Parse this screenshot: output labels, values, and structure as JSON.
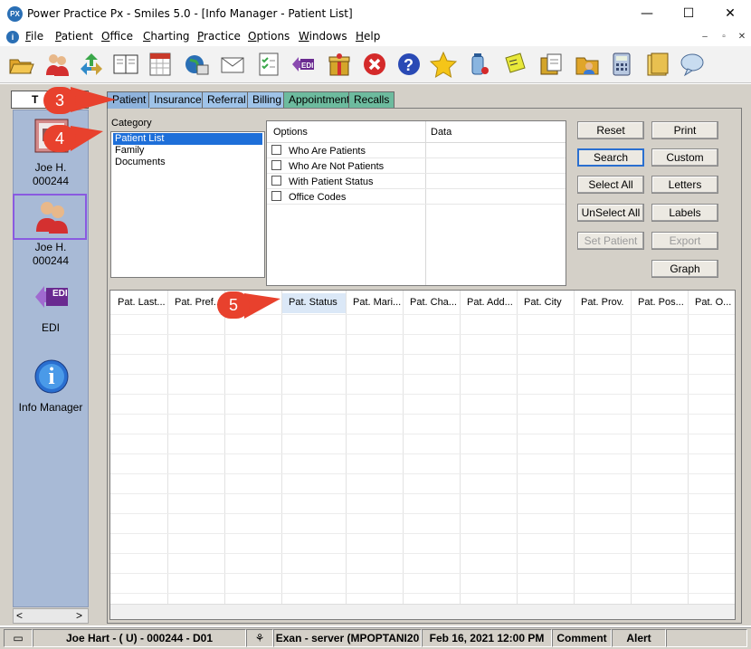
{
  "window": {
    "logo": "PX",
    "title": "Power Practice Px - Smiles 5.0 - [Info Manager - Patient List]",
    "minimize": "—",
    "maximize": "☐",
    "close": "✕"
  },
  "menu": [
    {
      "label": "File",
      "accel": "F",
      "rest": "ile"
    },
    {
      "label": "Patient",
      "accel": "P",
      "rest": "atient"
    },
    {
      "label": "Office",
      "accel": "O",
      "rest": "ffice"
    },
    {
      "label": "Charting",
      "accel": "C",
      "rest": "harting"
    },
    {
      "label": "Practice",
      "accel": "P",
      "rest": "ractice"
    },
    {
      "label": "Options",
      "accel": "O",
      "rest": "ptions"
    },
    {
      "label": "Windows",
      "accel": "W",
      "rest": "indows"
    },
    {
      "label": "Help",
      "accel": "H",
      "rest": "elp"
    }
  ],
  "mdi_controls": {
    "minimize": "–",
    "restore": "▫",
    "close": "✕"
  },
  "toolbar_icons": [
    "open-folder-icon",
    "patient-icon",
    "recycle-icon",
    "book-icon",
    "calendar-chart-icon",
    "globe-icon",
    "mail-icon",
    "checklist-icon",
    "edi-icon",
    "gift-icon",
    "cancel-icon",
    "help-icon",
    "star-icon",
    "medicine-icon",
    "note-icon",
    "document-icon",
    "folder-person-icon",
    "calculator-icon",
    "folder-icon",
    "speech-bubble-icon"
  ],
  "sidebar": {
    "header": "T",
    "items": [
      {
        "name": "Joe H.",
        "id": "000244"
      },
      {
        "name": "Joe H.",
        "id": "000244"
      },
      {
        "name": "EDI"
      },
      {
        "name": "Info Manager"
      }
    ],
    "edi_glyph": "EDI",
    "info_glyph": "i",
    "scroll_left": "<",
    "scroll_right": ">"
  },
  "tabs": [
    "Patient",
    "Insurance",
    "Referral",
    "Billing",
    "Appointment",
    "Recalls"
  ],
  "category": {
    "label": "Category",
    "items": [
      "Patient List",
      "Family",
      "Documents"
    ],
    "selected": "Patient List"
  },
  "options": {
    "header": "Options",
    "data_header": "Data",
    "rows": [
      "Who Are Patients",
      "Who Are Not Patients",
      "With Patient Status",
      "Office Codes"
    ]
  },
  "buttons": {
    "reset": "Reset",
    "print": "Print",
    "search": "Search",
    "custom": "Custom",
    "select_all": "Select All",
    "letters": "Letters",
    "unselect_all": "UnSelect All",
    "labels": "Labels",
    "set_patient": "Set Patient",
    "export": "Export",
    "graph": "Graph"
  },
  "grid": {
    "columns": [
      "Pat. Last...",
      "Pat. Pref...",
      "Pat. ...o",
      "Pat. Status",
      "Pat. Mari...",
      "Pat. Cha...",
      "Pat. Add...",
      "Pat. City",
      "Pat. Prov.",
      "Pat. Pos...",
      "Pat. O..."
    ],
    "selected_column": "Pat. Status"
  },
  "callouts": [
    "3",
    "4",
    "5"
  ],
  "statusbar": {
    "patient": "Joe Hart - ( U) - 000244 - D01",
    "server": "Exan - server (MPOPTANI20",
    "datetime": "Feb 16, 2021 12:00 PM",
    "comment": "Comment",
    "alert": "Alert"
  },
  "colors": {
    "accent": "#1e6fd9",
    "callout": "#e8412d",
    "tab_blue": "#9fc3e8",
    "tab_teal": "#6dbb9e",
    "sidebar_bg": "#a8bad6"
  }
}
